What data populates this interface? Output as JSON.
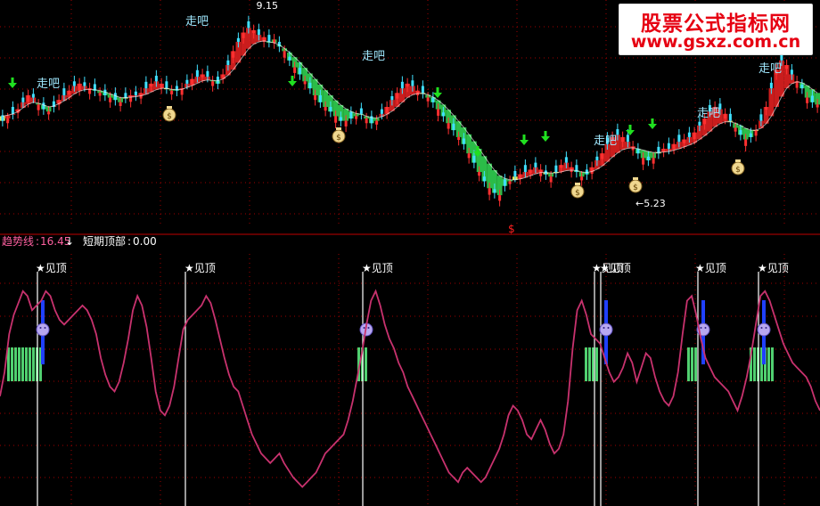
{
  "watermark": {
    "line1": "股票公式指标网",
    "line2": "www.gsxz.com.cn"
  },
  "indicator_bar": {
    "trend_label": "趋势线",
    "trend_value": "16.45",
    "trend_arrow": "↓",
    "short_top_label": "短期顶部",
    "short_top_value": "0.00",
    "center_marker": "$"
  },
  "colors": {
    "background": "#000000",
    "grid": "#a00000",
    "candle_up": "#ff3030",
    "candle_down": "#40e0ff",
    "ribbon_up": "#e02020",
    "ribbon_down": "#30d050",
    "ribbon_flat": "#ffff60",
    "trend_line": "#c8326e",
    "signal_line": "#ffffff",
    "green_bar": "#50d070",
    "blue_bar": "#2040ff",
    "arrow": "#20e020",
    "label": "#a0e8ff"
  },
  "chart_data": [
    {
      "type": "candlestick",
      "panel": "price",
      "price_labels": [
        {
          "text": "9.15",
          "x": 50
        },
        {
          "text": "5.23",
          "x": 124
        }
      ],
      "close": [
        6.9,
        6.95,
        7.05,
        7.15,
        7.3,
        7.45,
        7.4,
        7.25,
        7.15,
        7.1,
        7.2,
        7.35,
        7.45,
        7.55,
        7.65,
        7.7,
        7.65,
        7.6,
        7.55,
        7.5,
        7.45,
        7.4,
        7.35,
        7.3,
        7.4,
        7.45,
        7.45,
        7.5,
        7.6,
        7.7,
        7.75,
        7.7,
        7.6,
        7.55,
        7.55,
        7.6,
        7.7,
        7.8,
        7.85,
        7.9,
        7.85,
        7.75,
        7.7,
        7.9,
        8.1,
        8.4,
        8.6,
        8.8,
        8.9,
        8.85,
        8.75,
        8.7,
        8.6,
        8.65,
        8.5,
        8.4,
        8.2,
        8.05,
        7.9,
        7.75,
        7.6,
        7.45,
        7.3,
        7.2,
        7.1,
        7.0,
        6.9,
        6.9,
        6.95,
        7.0,
        7.05,
        6.95,
        6.85,
        6.9,
        7.05,
        7.2,
        7.35,
        7.5,
        7.6,
        7.7,
        7.65,
        7.55,
        7.5,
        7.4,
        7.3,
        7.15,
        7.0,
        6.85,
        6.7,
        6.55,
        6.4,
        6.2,
        6.0,
        5.8,
        5.6,
        5.45,
        5.35,
        5.3,
        5.5,
        5.6,
        5.7,
        5.75,
        5.8,
        5.85,
        5.9,
        5.85,
        5.75,
        5.7,
        5.8,
        5.95,
        6.0,
        5.9,
        5.8,
        5.7,
        5.75,
        5.9,
        6.05,
        6.2,
        6.4,
        6.55,
        6.6,
        6.55,
        6.45,
        6.35,
        6.2,
        6.1,
        6.05,
        6.1,
        6.2,
        6.3,
        6.3,
        6.4,
        6.45,
        6.5,
        6.55,
        6.65,
        6.8,
        6.95,
        7.1,
        7.2,
        7.15,
        7.05,
        6.9,
        6.75,
        6.6,
        6.5,
        6.55,
        6.7,
        6.9,
        7.2,
        7.6,
        8.0,
        8.2,
        8.1,
        7.9,
        7.75,
        7.6,
        7.4,
        7.3,
        7.25
      ],
      "open_offset_pattern": [
        0.12,
        -0.1,
        0.15,
        -0.08,
        0.1,
        -0.14,
        0.08,
        -0.12,
        0.14,
        -0.06
      ],
      "ma": [
        7.0,
        7.02,
        7.05,
        7.1,
        7.18,
        7.26,
        7.3,
        7.28,
        7.24,
        7.2,
        7.22,
        7.27,
        7.33,
        7.4,
        7.48,
        7.54,
        7.57,
        7.58,
        7.57,
        7.55,
        7.52,
        7.48,
        7.44,
        7.4,
        7.4,
        7.41,
        7.42,
        7.44,
        7.47,
        7.52,
        7.57,
        7.6,
        7.6,
        7.58,
        7.57,
        7.58,
        7.62,
        7.66,
        7.71,
        7.76,
        7.78,
        7.77,
        7.76,
        7.8,
        7.88,
        8.0,
        8.15,
        8.3,
        8.45,
        8.55,
        8.6,
        8.62,
        8.6,
        8.58,
        8.53,
        8.46,
        8.37,
        8.27,
        8.16,
        8.04,
        7.92,
        7.8,
        7.68,
        7.56,
        7.45,
        7.34,
        7.24,
        7.16,
        7.1,
        7.06,
        7.04,
        7.0,
        6.97,
        6.96,
        6.99,
        7.04,
        7.11,
        7.2,
        7.3,
        7.4,
        7.46,
        7.49,
        7.49,
        7.46,
        7.41,
        7.34,
        7.25,
        7.14,
        7.02,
        6.89,
        6.76,
        6.61,
        6.46,
        6.3,
        6.14,
        5.98,
        5.84,
        5.72,
        5.66,
        5.63,
        5.63,
        5.65,
        5.68,
        5.72,
        5.76,
        5.79,
        5.79,
        5.78,
        5.78,
        5.8,
        5.83,
        5.84,
        5.83,
        5.8,
        5.79,
        5.81,
        5.86,
        5.93,
        6.02,
        6.12,
        6.21,
        6.28,
        6.31,
        6.32,
        6.3,
        6.27,
        6.24,
        6.22,
        6.22,
        6.23,
        6.24,
        6.27,
        6.3,
        6.34,
        6.38,
        6.43,
        6.5,
        6.58,
        6.67,
        6.77,
        6.84,
        6.88,
        6.88,
        6.85,
        6.8,
        6.74,
        6.7,
        6.7,
        6.74,
        6.84,
        7.0,
        7.2,
        7.42,
        7.6,
        7.7,
        7.74,
        7.72,
        7.66,
        7.58,
        7.5
      ]
    },
    {
      "type": "line",
      "panel": "indicator",
      "series": [
        {
          "name": "趋势线",
          "values": [
            46,
            56,
            72,
            80,
            85,
            90,
            88,
            82,
            84,
            86,
            90,
            88,
            82,
            78,
            76,
            78,
            80,
            82,
            84,
            82,
            78,
            72,
            62,
            55,
            50,
            48,
            52,
            60,
            70,
            82,
            88,
            84,
            75,
            62,
            48,
            40,
            38,
            42,
            50,
            62,
            74,
            78,
            80,
            82,
            84,
            88,
            85,
            78,
            70,
            62,
            55,
            50,
            48,
            42,
            36,
            30,
            26,
            22,
            20,
            18,
            20,
            22,
            18,
            15,
            12,
            10,
            8,
            10,
            12,
            14,
            18,
            22,
            24,
            26,
            28,
            30,
            36,
            44,
            54,
            64,
            76,
            86,
            90,
            84,
            76,
            70,
            66,
            60,
            56,
            50,
            46,
            42,
            38,
            34,
            30,
            26,
            22,
            18,
            14,
            12,
            10,
            14,
            16,
            14,
            12,
            10,
            12,
            16,
            20,
            24,
            30,
            38,
            42,
            40,
            36,
            30,
            28,
            32,
            36,
            32,
            26,
            22,
            24,
            30,
            44,
            66,
            82,
            86,
            80,
            72,
            70,
            68,
            62,
            56,
            52,
            54,
            58,
            64,
            60,
            52,
            58,
            64,
            62,
            54,
            48,
            44,
            42,
            46,
            56,
            72,
            86,
            88,
            80,
            70,
            62,
            58,
            54,
            52,
            50,
            48,
            44,
            40,
            46,
            54,
            64,
            76,
            88,
            90,
            86,
            80,
            74,
            68,
            64,
            60,
            58,
            56,
            54,
            50,
            44,
            40
          ]
        }
      ],
      "signal_labels": [
        "★见顶",
        "★见顶",
        "★见顶",
        "★见顶",
        "★见顶",
        "★见顶",
        "★见顶"
      ],
      "ylim": [
        0,
        100
      ]
    }
  ],
  "annotations": {
    "go_label": "走吧",
    "go_positions": [
      [
        53,
        93
      ],
      [
        220,
        23
      ],
      [
        418,
        62
      ],
      [
        678,
        157
      ],
      [
        794,
        126
      ],
      [
        863,
        76
      ]
    ],
    "money_label": "$",
    "money_positions": [
      [
        190,
        129
      ],
      [
        380,
        153
      ],
      [
        648,
        215
      ],
      [
        713,
        209
      ],
      [
        828,
        189
      ]
    ],
    "arrow_positions": [
      [
        14,
        93
      ],
      [
        328,
        91
      ],
      [
        491,
        104
      ],
      [
        536,
        170
      ],
      [
        588,
        157
      ],
      [
        612,
        153
      ],
      [
        707,
        146
      ],
      [
        732,
        139
      ]
    ]
  },
  "signals": [
    {
      "x": 42,
      "label_x": 40,
      "smiley": true,
      "blue_bar": true,
      "green_from": 8,
      "green_to": 45
    },
    {
      "x": 208,
      "label_x": 207,
      "smiley": false,
      "blue_bar": false,
      "green_from": 0,
      "green_to": 0
    },
    {
      "x": 407,
      "label_x": 406,
      "smiley": true,
      "blue_bar": false,
      "green_from": 401,
      "green_to": 410
    },
    {
      "x": 667,
      "label_x": 664,
      "smiley": false,
      "blue_bar": false,
      "green_from": 656,
      "green_to": 672
    },
    {
      "x": 674,
      "label_x": 673,
      "smiley": true,
      "blue_bar": true,
      "green_from": 0,
      "green_to": 0
    },
    {
      "x": 783,
      "label_x": 780,
      "smiley": true,
      "blue_bar": true,
      "green_from": 771,
      "green_to": 780
    },
    {
      "x": 851,
      "label_x": 850,
      "smiley": true,
      "blue_bar": true,
      "green_from": 841,
      "green_to": 866
    }
  ]
}
